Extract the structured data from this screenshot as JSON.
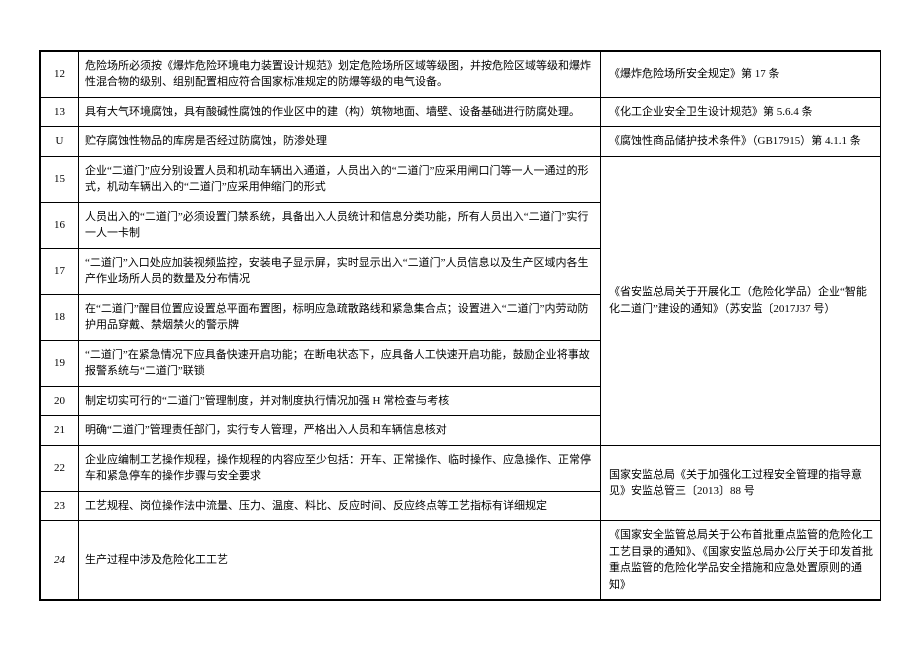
{
  "rows": [
    {
      "num": "12",
      "content": "危险场所必须按《爆炸危险环境电力装置设计规范》划定危险场所区域等级图，并按危险区域等级和爆炸性混合物的级别、组别配置相应符合国家标准规定的防爆等级的电气设备。",
      "ref": "《爆炸危险场所安全规定》第 17 条",
      "italic": false
    },
    {
      "num": "13",
      "content": "具有大气环境腐蚀，具有酸碱性腐蚀的作业区中的建（构）筑物地面、墙壁、设备基础进行防腐处理。",
      "ref": "《化工企业安全卫生设计规范》第 5.6.4 条",
      "italic": false
    },
    {
      "num": "U",
      "content": "贮存腐蚀性物品的库房是否经过防腐蚀，防渗处理",
      "ref": "《腐蚀性商品储护技术条件》（GB17915）第 4.1.1 条",
      "italic": false
    },
    {
      "num": "15",
      "content": "企业“二道门”应分别设置人员和机动车辆出入通道，人员出入的“二道门”应采用闸口门等一人一通过的形式，机动车辆出入的“二道门”应采用伸缩门的形式",
      "italic": false
    },
    {
      "num": "16",
      "content": "人员出入的“二道门”必须设置门禁系统，具备出入人员统计和信息分类功能，所有人员出入“二道门”实行一人一卡制",
      "italic": false
    },
    {
      "num": "17",
      "content": "“二道门”入口处应加装视频监控，安装电子显示屏，实时显示出入“二道门”人员信息以及生产区域内各生产作业场所人员的数量及分布情况",
      "italic": false
    },
    {
      "num": "18",
      "content": "在“二道门”醒目位置应设置总平面布置图，标明应急疏散路线和紧急集合点；设置进入“二道门”内劳动防护用品穿戴、禁烟禁火的警示牌",
      "italic": false
    },
    {
      "num": "19",
      "content": "“二道门”在紧急情况下应具备快速开启功能；在断电状态下，应具备人工快速开启功能，鼓励企业将事故报警系统与“二道门”联锁",
      "italic": false
    },
    {
      "num": "20",
      "content": "制定切实可行的“二道门”管理制度，并对制度执行情况加强 H 常检查与考核",
      "italic": false
    },
    {
      "num": "21",
      "content": "明确“二道门”管理责任部门，实行专人管理，严格出入人员和车辆信息核对",
      "italic": false
    },
    {
      "num": "22",
      "content": "企业应编制工艺操作规程，操作规程的内容应至少包括：开车、正常操作、临时操作、应急操作、正常停车和紧急停车的操作步骤与安全要求",
      "italic": false
    },
    {
      "num": "23",
      "content": "工艺规程、岗位操作法中流量、压力、温度、料比、反应时间、反应终点等工艺指标有详细规定",
      "italic": false
    },
    {
      "num": "24",
      "content": "生产过程中涉及危险化工工艺",
      "ref": "《国家安全监管总局关于公布首批重点监管的危险化工工艺目录的通知》、《国家安监总局办公厅关于印发首批重点监管的危险化学品安全措施和应急处置原则的通知》",
      "italic": true
    }
  ],
  "merged_ref_15_21": "《省安监总局关于开展化工（危险化学品）企业“智能化二道门”建设的通知》（苏安监〔2017J37 号）",
  "merged_ref_22_23": "国家安监总局《关于加强化工过程安全管理的指导意见》安监总管三〔2013〕88 号"
}
